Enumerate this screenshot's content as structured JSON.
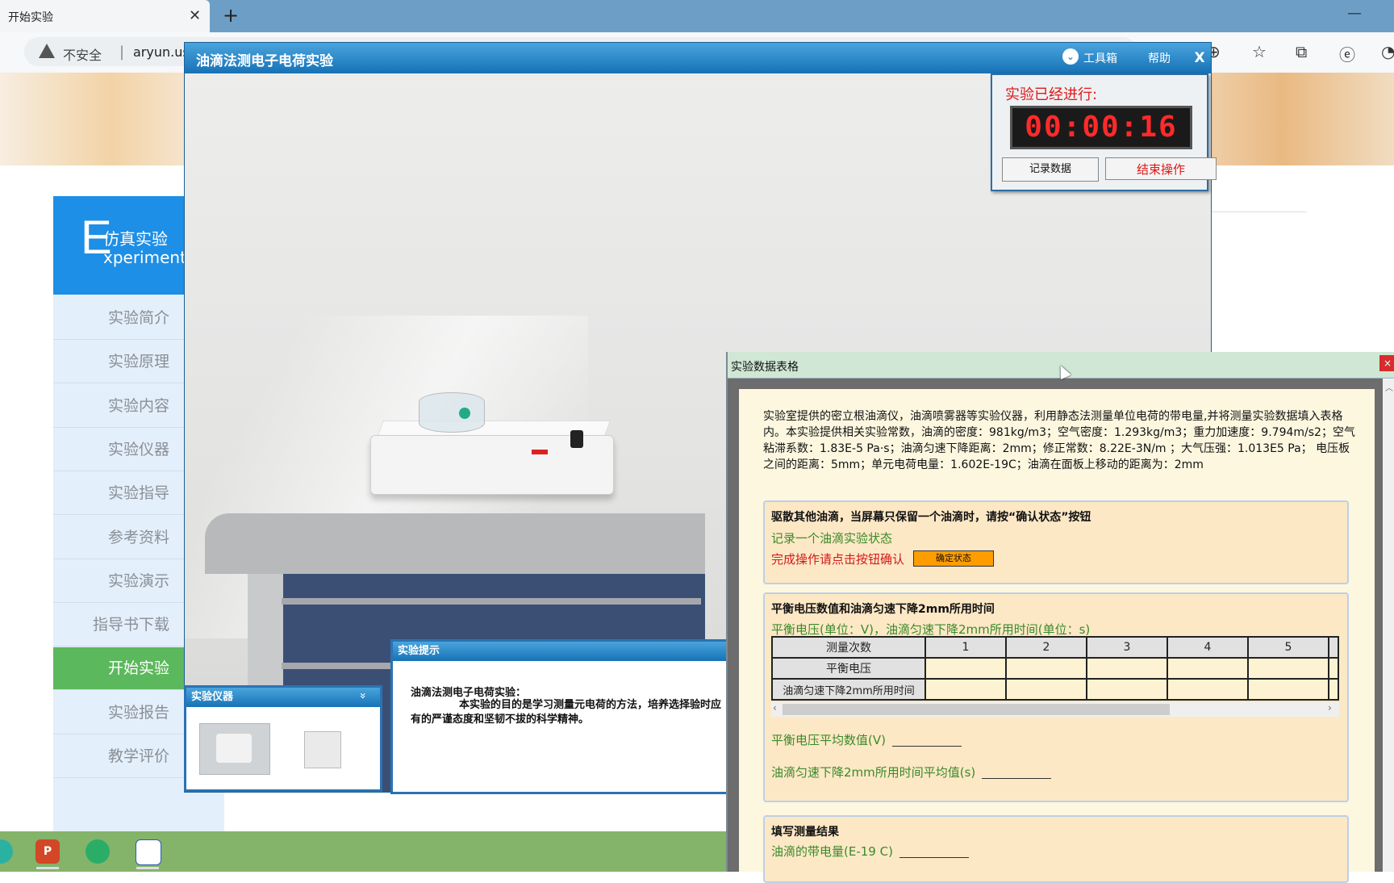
{
  "browser": {
    "tab_title": "开始实验",
    "tab_close": "✕",
    "new_tab": "+",
    "window_min": "—",
    "security_label": "不安全",
    "separator": "|",
    "url": "aryun.us",
    "toolbar_icons": [
      "extensions-icon",
      "favorites-icon",
      "collections-icon",
      "ie-mode-icon",
      "profile-icon"
    ],
    "toolbar_glyphs": [
      "⊕",
      "☆",
      "⧉",
      "ⓔ",
      "◔"
    ]
  },
  "site": {
    "sidebar_header": {
      "big_letter": "E",
      "cn": "仿真实验",
      "en": "xperiment"
    },
    "sidebar_items": [
      {
        "label": "实验简介",
        "active": false
      },
      {
        "label": "实验原理",
        "active": false
      },
      {
        "label": "实验内容",
        "active": false
      },
      {
        "label": "实验仪器",
        "active": false
      },
      {
        "label": "实验指导",
        "active": false
      },
      {
        "label": "参考资料",
        "active": false
      },
      {
        "label": "实验演示",
        "active": false
      },
      {
        "label": "指导书下载",
        "active": false
      },
      {
        "label": "开始实验",
        "active": true
      },
      {
        "label": "实验报告",
        "active": false
      },
      {
        "label": "教学评价",
        "active": false
      }
    ]
  },
  "experiment": {
    "title": "油滴法测电子电荷实验",
    "toolbox_label": "工具箱",
    "toolbox_glyph": "⌄",
    "help_label": "帮助",
    "close_label": "X"
  },
  "timer": {
    "label": "实验已经进行:",
    "value": "00:00:16",
    "record_button": "记录数据",
    "end_button": "结束操作"
  },
  "tips": {
    "title": "实验提示",
    "heading": "油滴法测电子电荷实验：",
    "body": "本实验的目的是学习测量元电荷的方法，培养选择验时应有的严谨态度和坚韧不拔的科学精神。"
  },
  "instruments": {
    "title": "实验仪器",
    "collapse_glyph": "»"
  },
  "data_table": {
    "title": "实验数据表格",
    "close_glyph": "×",
    "scroll_up_glyph": "︿",
    "intro": "实验室提供的密立根油滴仪，油滴喷雾器等实验仪器，利用静态法测量单位电荷的带电量,并将测量实验数据填入表格内。本实验提供相关实验常数，油滴的密度：981kg/m3；空气密度：1.293kg/m3；重力加速度：9.794m/s2；空气粘滞系数：1.83E-5 Pa·s；油滴匀速下降距离：2mm；修正常数：8.22E-3N/m ；大气压强：1.013E5 Pa； 电压板之间的距离：5mm；单元电荷电量：1.602E-19C；油滴在面板上移动的距离为：2mm",
    "step1": {
      "title": "驱散其他油滴，当屏幕只保留一个油滴时，请按“确认状态”按钮",
      "line1": "记录一个油滴实验状态",
      "line2": "完成操作请点击按钮确认",
      "confirm_button": "确定状态"
    },
    "step2": {
      "title": "平衡电压数值和油滴匀速下降2mm所用时间",
      "subtitle": "平衡电压(单位：V)，油滴匀速下降2mm所用时间(单位：s)",
      "header_label": "测量次数",
      "columns": [
        "1",
        "2",
        "3",
        "4",
        "5"
      ],
      "rows": [
        {
          "label": "平衡电压",
          "values": [
            "",
            "",
            "",
            "",
            ""
          ]
        },
        {
          "label": "油滴匀速下降2mm所用时间",
          "values": [
            "",
            "",
            "",
            "",
            ""
          ]
        }
      ],
      "scroll_left": "‹",
      "scroll_right": "›",
      "avg_voltage_label": "平衡电压平均数值(V)",
      "avg_time_label": "油滴匀速下降2mm所用时间平均值(s)"
    },
    "step3": {
      "title": "填写测量结果",
      "charge_label": "油滴的带电量(E-19 C)"
    }
  },
  "taskbar": {
    "icons": [
      "edge-icon",
      "powerpoint-icon",
      "wechat-icon",
      "reader-icon"
    ],
    "ppt_letter": "P"
  }
}
